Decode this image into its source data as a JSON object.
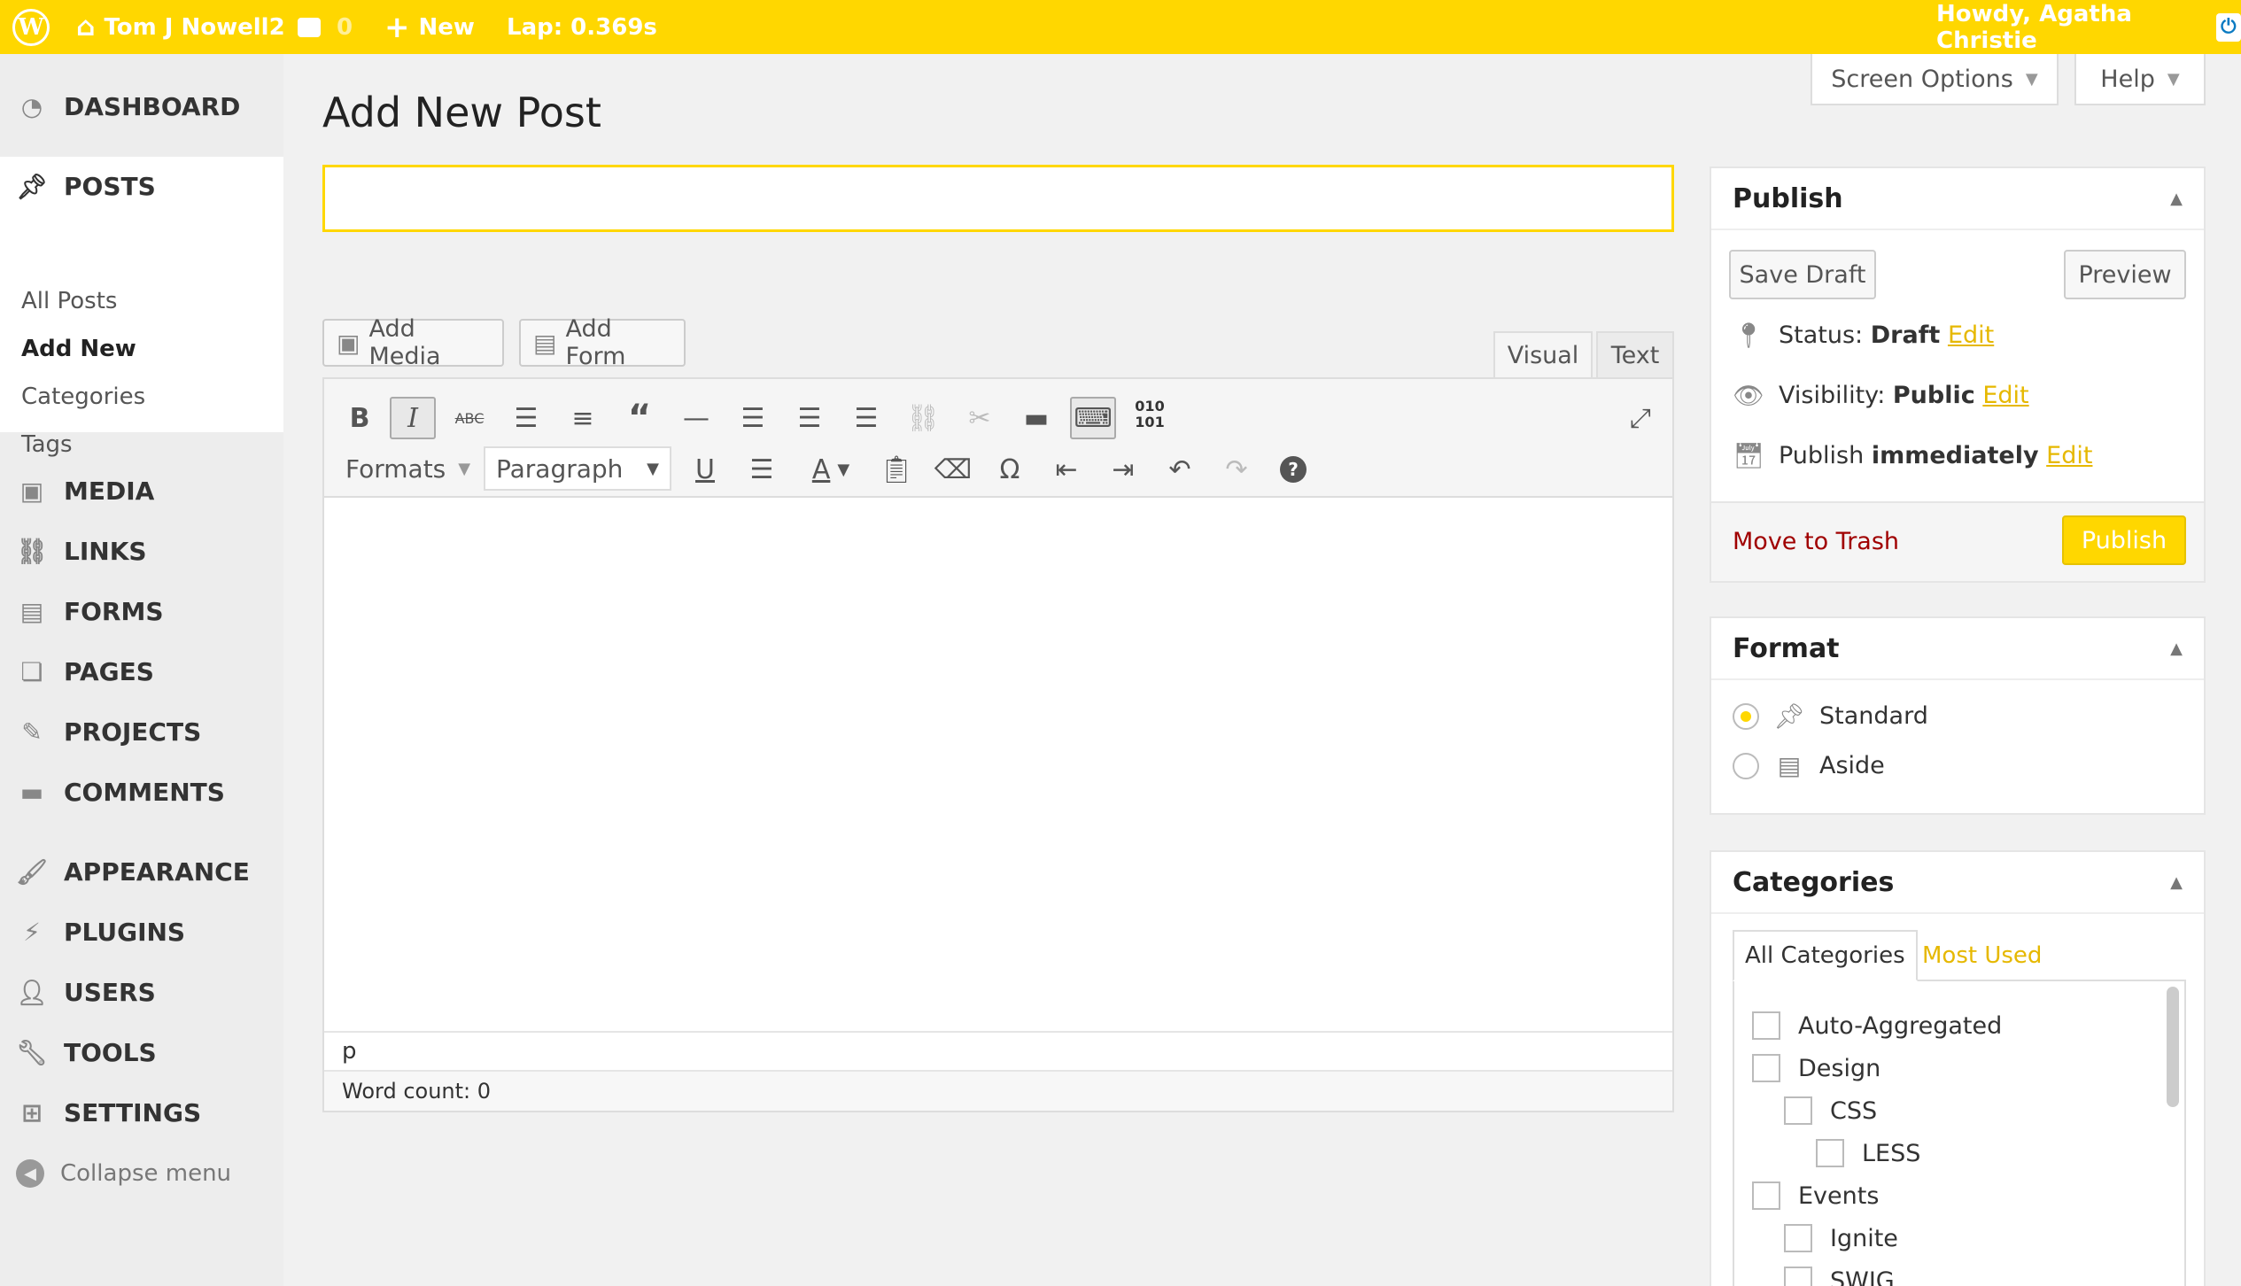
{
  "adminbar": {
    "site_name": "Tom J Nowell2",
    "comments_count": "0",
    "new_label": "New",
    "lap": "Lap: 0.369s",
    "howdy": "Howdy, Agatha Christie"
  },
  "sidebar": {
    "dashboard": "DASHBOARD",
    "posts": "POSTS",
    "posts_submenu": [
      "All Posts",
      "Add New",
      "Categories",
      "Tags"
    ],
    "media": "MEDIA",
    "links": "LINKS",
    "forms": "FORMS",
    "pages": "PAGES",
    "projects": "PROJECTS",
    "comments": "COMMENTS",
    "appearance": "APPEARANCE",
    "plugins": "PLUGINS",
    "users": "USERS",
    "tools": "TOOLS",
    "settings": "SETTINGS",
    "collapse": "Collapse menu"
  },
  "screen_options": "Screen Options",
  "help": "Help",
  "page_title": "Add New Post",
  "title_input_value": "",
  "editor": {
    "add_media": "Add Media",
    "add_form": "Add Form",
    "tab_visual": "Visual",
    "tab_text": "Text",
    "formats": "Formats",
    "paragraph": "Paragraph",
    "binary_top": "010",
    "binary_bottom": "101",
    "path": "p",
    "word_count": "Word count: 0"
  },
  "publish_box": {
    "title": "Publish",
    "save_draft": "Save Draft",
    "preview": "Preview",
    "status_label": "Status:",
    "status_value": "Draft",
    "visibility_label": "Visibility:",
    "visibility_value": "Public",
    "publish_label": "Publish",
    "publish_value": "immediately",
    "edit": "Edit",
    "trash": "Move to Trash",
    "publish_button": "Publish"
  },
  "format_box": {
    "title": "Format",
    "options": [
      "Standard",
      "Aside"
    ],
    "selected": "Standard"
  },
  "categories_box": {
    "title": "Categories",
    "tab_all": "All Categories",
    "tab_most_used": "Most Used",
    "items": [
      "Auto-Aggregated",
      "Design",
      "CSS",
      "LESS",
      "Events",
      "Ignite",
      "SWIG"
    ]
  },
  "colors": {
    "accent": "#ffd700",
    "trash": "#a00000",
    "edit_link": "#e6b800"
  }
}
